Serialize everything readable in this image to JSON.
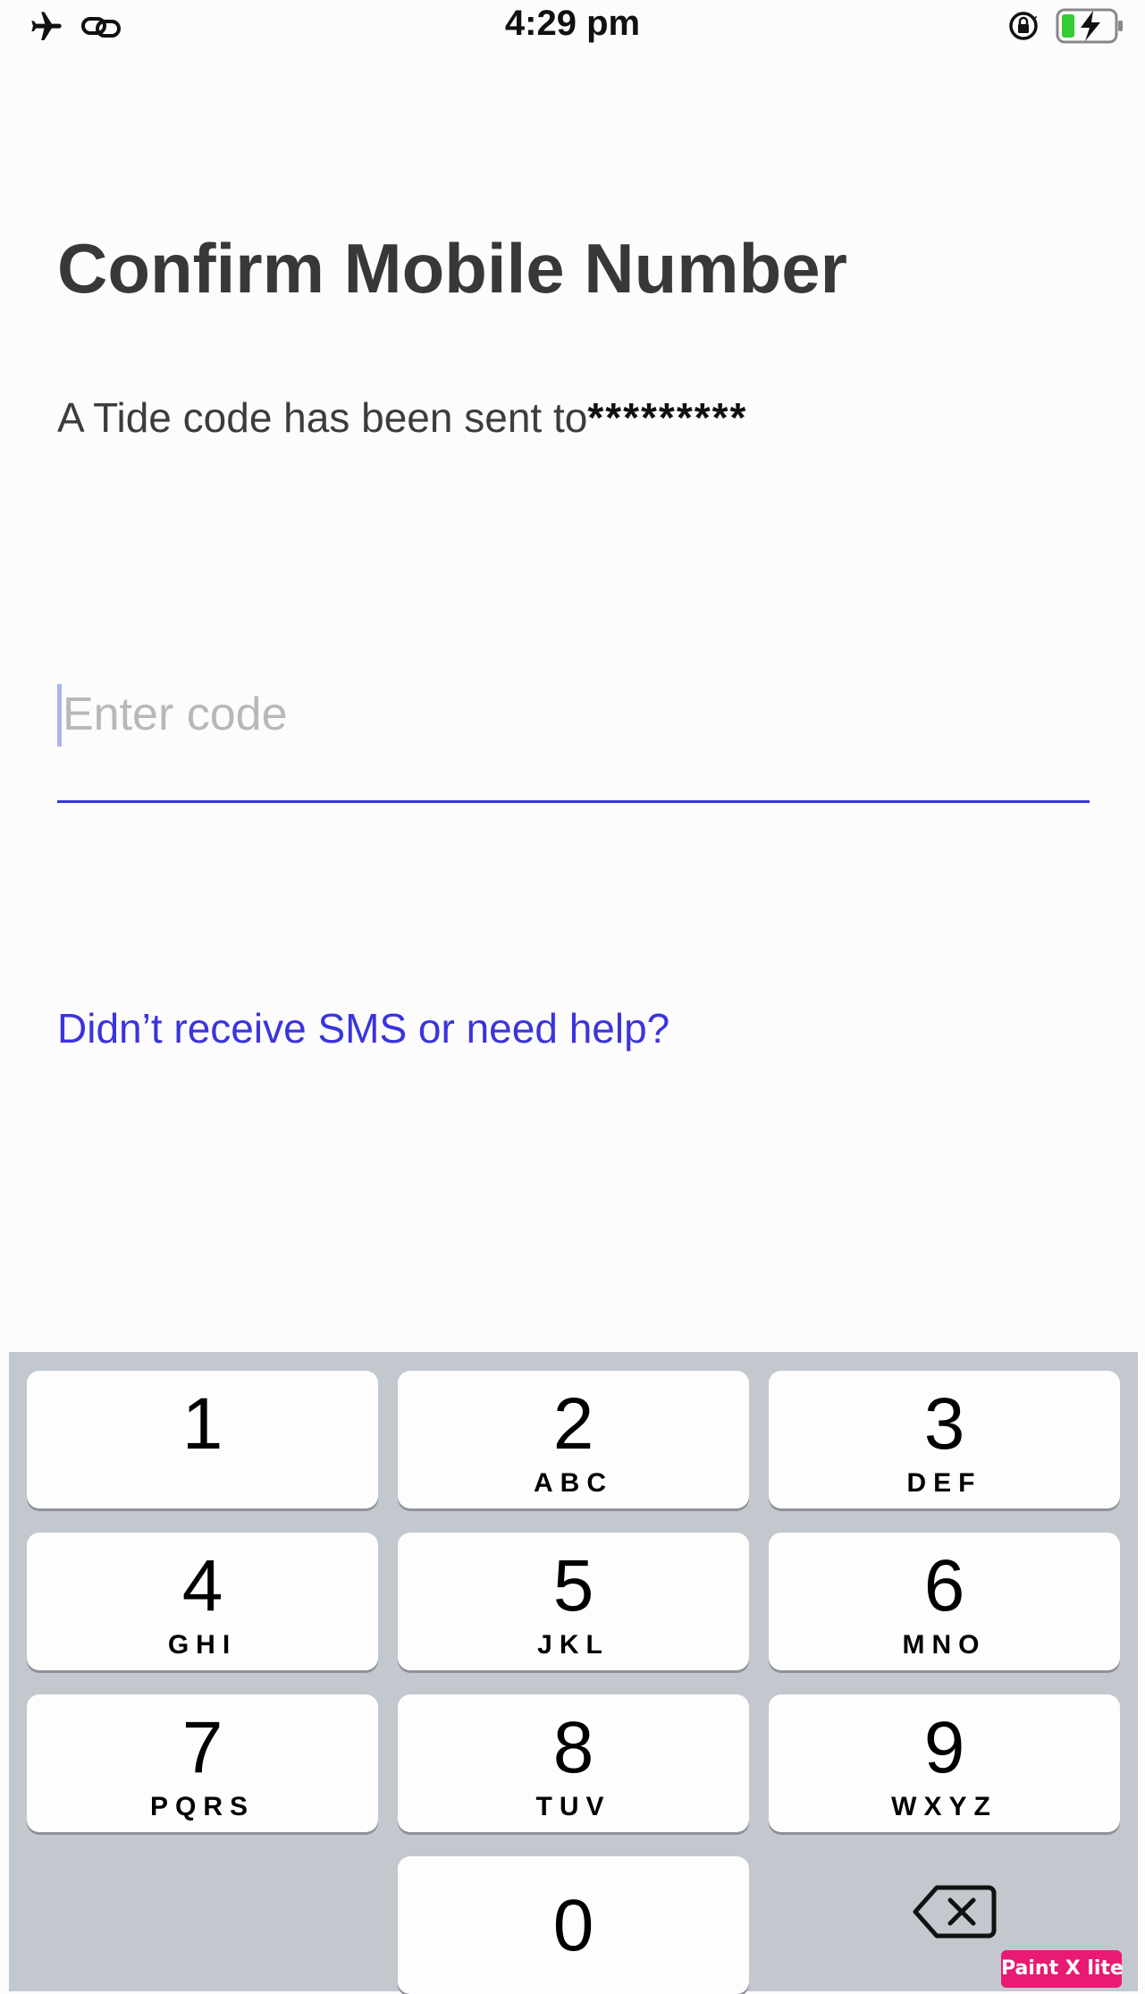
{
  "status_bar": {
    "time": "4:29 pm",
    "icons": [
      "airplane-icon",
      "link-icon",
      "orientation-lock-icon",
      "battery-charging-icon"
    ],
    "battery_color": "#33cc33"
  },
  "title": "Confirm Mobile Number",
  "sent_message": {
    "prefix": "A Tide code has been sent to",
    "masked_number": "*********"
  },
  "code_field": {
    "placeholder": "Enter code",
    "value": ""
  },
  "help_link": "Didn’t receive SMS or need help?",
  "keypad": {
    "keys": [
      {
        "digit": "1",
        "letters": ""
      },
      {
        "digit": "2",
        "letters": "ABC"
      },
      {
        "digit": "3",
        "letters": "DEF"
      },
      {
        "digit": "4",
        "letters": "GHI"
      },
      {
        "digit": "5",
        "letters": "JKL"
      },
      {
        "digit": "6",
        "letters": "MNO"
      },
      {
        "digit": "7",
        "letters": "PQRS"
      },
      {
        "digit": "8",
        "letters": "TUV"
      },
      {
        "digit": "9",
        "letters": "WXYZ"
      },
      {
        "digit": "0",
        "letters": ""
      }
    ],
    "backspace_icon": "backspace-icon"
  },
  "watermark": "Paint X lite",
  "colors": {
    "accent": "#3a33e0",
    "title_text": "#383838",
    "keypad_bg": "#c3c8cf",
    "watermark_bg": "#e81a72"
  }
}
